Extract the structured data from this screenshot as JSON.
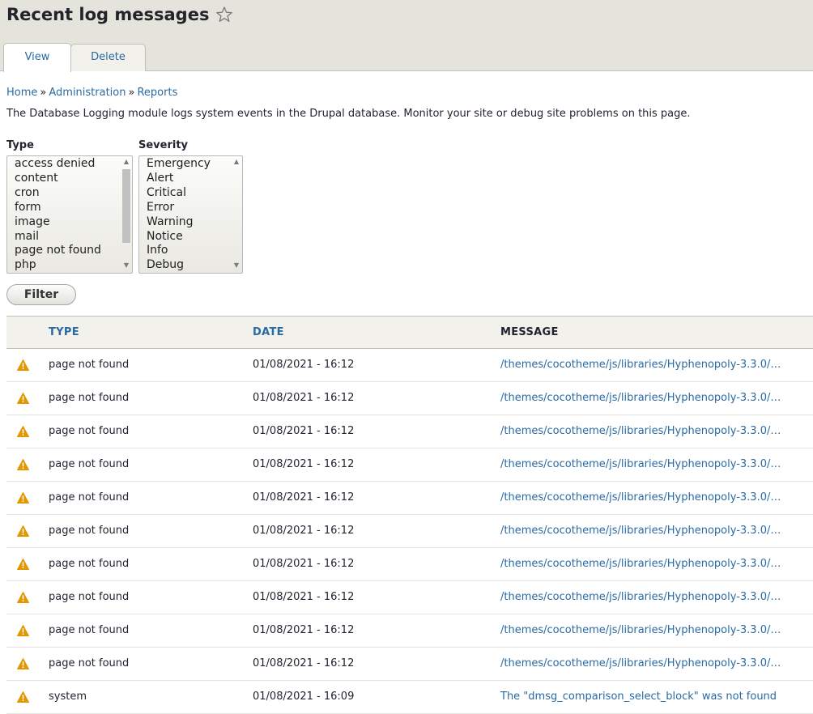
{
  "page": {
    "title": "Recent log messages",
    "favorite_icon": "star-icon"
  },
  "tabs": [
    {
      "label": "View",
      "active": true
    },
    {
      "label": "Delete",
      "active": false
    }
  ],
  "breadcrumb": {
    "separator": "»",
    "items": [
      "Home",
      "Administration",
      "Reports"
    ]
  },
  "description": "The Database Logging module logs system events in the Drupal database. Monitor your site or debug site problems on this page.",
  "filters": {
    "type": {
      "label": "Type",
      "options": [
        "access denied",
        "content",
        "cron",
        "form",
        "image",
        "mail",
        "page not found",
        "php"
      ]
    },
    "severity": {
      "label": "Severity",
      "options": [
        "Emergency",
        "Alert",
        "Critical",
        "Error",
        "Warning",
        "Notice",
        "Info",
        "Debug"
      ]
    },
    "submit_label": "Filter"
  },
  "table": {
    "headers": {
      "type": "TYPE",
      "date": "DATE",
      "message": "MESSAGE"
    },
    "rows": [
      {
        "severity_icon": "warning-icon",
        "type": "page not found",
        "date": "01/08/2021 - 16:12",
        "message": "/themes/cocotheme/js/libraries/Hyphenopoly-3.3.0/…"
      },
      {
        "severity_icon": "warning-icon",
        "type": "page not found",
        "date": "01/08/2021 - 16:12",
        "message": "/themes/cocotheme/js/libraries/Hyphenopoly-3.3.0/…"
      },
      {
        "severity_icon": "warning-icon",
        "type": "page not found",
        "date": "01/08/2021 - 16:12",
        "message": "/themes/cocotheme/js/libraries/Hyphenopoly-3.3.0/…"
      },
      {
        "severity_icon": "warning-icon",
        "type": "page not found",
        "date": "01/08/2021 - 16:12",
        "message": "/themes/cocotheme/js/libraries/Hyphenopoly-3.3.0/…"
      },
      {
        "severity_icon": "warning-icon",
        "type": "page not found",
        "date": "01/08/2021 - 16:12",
        "message": "/themes/cocotheme/js/libraries/Hyphenopoly-3.3.0/…"
      },
      {
        "severity_icon": "warning-icon",
        "type": "page not found",
        "date": "01/08/2021 - 16:12",
        "message": "/themes/cocotheme/js/libraries/Hyphenopoly-3.3.0/…"
      },
      {
        "severity_icon": "warning-icon",
        "type": "page not found",
        "date": "01/08/2021 - 16:12",
        "message": "/themes/cocotheme/js/libraries/Hyphenopoly-3.3.0/…"
      },
      {
        "severity_icon": "warning-icon",
        "type": "page not found",
        "date": "01/08/2021 - 16:12",
        "message": "/themes/cocotheme/js/libraries/Hyphenopoly-3.3.0/…"
      },
      {
        "severity_icon": "warning-icon",
        "type": "page not found",
        "date": "01/08/2021 - 16:12",
        "message": "/themes/cocotheme/js/libraries/Hyphenopoly-3.3.0/…"
      },
      {
        "severity_icon": "warning-icon",
        "type": "page not found",
        "date": "01/08/2021 - 16:12",
        "message": "/themes/cocotheme/js/libraries/Hyphenopoly-3.3.0/…"
      },
      {
        "severity_icon": "warning-icon",
        "type": "system",
        "date": "01/08/2021 - 16:09",
        "message": "The \"dmsg_comparison_select_block\" was not found"
      }
    ]
  },
  "colors": {
    "link": "#2a6aa3",
    "header_bg": "#e5e4dc",
    "warning": "#e29700"
  }
}
